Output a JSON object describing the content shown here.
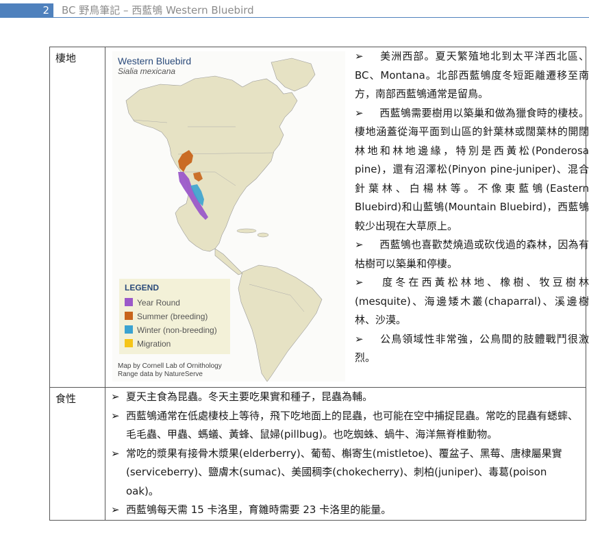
{
  "header": {
    "page_number": "2",
    "title": "BC 野鳥筆記 – 西藍鴝 Western Bluebird"
  },
  "habitat": {
    "label": "棲地",
    "map": {
      "title": "Western Bluebird",
      "scientific_name": "Sialia mexicana",
      "legend_title": "LEGEND",
      "legend": [
        {
          "label": "Year Round",
          "color": "#9b59c9"
        },
        {
          "label": "Summer (breeding)",
          "color": "#c8651b"
        },
        {
          "label": "Winter (non-breeding)",
          "color": "#3ba3d0"
        },
        {
          "label": "Migration",
          "color": "#f5c518"
        }
      ],
      "credit_line1": "Map by Cornell Lab of Ornithology",
      "credit_line2": "Range data by NatureServe",
      "land_color": "#e6e2c4",
      "water_color": "#fbfbf9"
    },
    "bullet": "➢",
    "paragraphs": [
      "美洲西部。夏天繁殖地北到太平洋西北區、BC、Montana。北部西藍鴝度冬短距離遷移至南方，南部西藍鴝通常是留鳥。",
      "西藍鴝需要樹用以築巢和做為獵食時的棲枝。棲地涵蓋從海平面到山區的針葉林或闊葉林的開闊林地和林地邊緣，特別是西黃松(Ponderosa pine)，還有沼澤松(Pinyon pine-juniper)、混合針葉林、白楊林等。不像東藍鴝(Eastern Bluebird)和山藍鴝(Mountain Bluebird)，西藍鴝較少出現在大草原上。",
      "西藍鴝也喜歡焚燒過或砍伐過的森林，因為有枯樹可以築巢和停棲。",
      "度冬在西黃松林地、橡樹、牧豆樹林(mesquite)、海邊矮木叢(chaparral)、溪邊樹林、沙漠。",
      "公鳥領域性非常強，公鳥間的肢體戰鬥很激烈。"
    ]
  },
  "diet": {
    "label": "食性",
    "bullet": "➢",
    "items": [
      "夏天主食為昆蟲。冬天主要吃果實和種子，昆蟲為輔。",
      "西藍鴝通常在低處棲枝上等待，飛下吃地面上的昆蟲，也可能在空中捕捉昆蟲。常吃的昆蟲有蟋蟀、毛毛蟲、甲蟲、螞蟻、黃蜂、鼠婦(pillbug)。也吃蜘蛛、蝸牛、海洋無脊椎動物。",
      "常吃的漿果有接骨木漿果(elderberry)、葡萄、槲寄生(mistletoe)、覆盆子、黑莓、唐棣屬果實(serviceberry)、鹽膚木(sumac)、美國稠李(chokecherry)、刺柏(juniper)、毒葛(poison oak)。",
      "西藍鴝每天需 15 卡洛里，育雛時需要 23 卡洛里的能量。"
    ]
  }
}
